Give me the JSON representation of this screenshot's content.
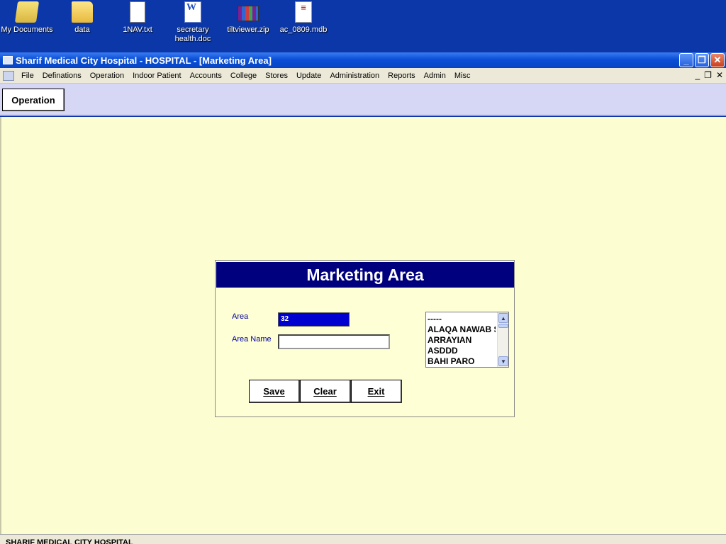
{
  "desktop": {
    "icons": [
      {
        "label": "My Documents",
        "icon": "my-documents-icon"
      },
      {
        "label": "data",
        "icon": "folder-icon"
      },
      {
        "label": "1NAV.txt",
        "icon": "text-file-icon"
      },
      {
        "label": "secretary health.doc",
        "icon": "word-document-icon"
      },
      {
        "label": "tiltviewer.zip",
        "icon": "winrar-archive-icon"
      },
      {
        "label": "ac_0809.mdb",
        "icon": "access-database-icon"
      }
    ]
  },
  "window": {
    "title": "Sharif Medical City Hospital - HOSPITAL - [Marketing Area]"
  },
  "menu": {
    "items": [
      "File",
      "Definations",
      "Operation",
      "Indoor Patient",
      "Accounts",
      "College",
      "Stores",
      "Update",
      "Administration",
      "Reports",
      "Admin",
      "Misc"
    ]
  },
  "toolbar": {
    "operation_label": "Operation"
  },
  "dialog": {
    "title": "Marketing Area",
    "area_label": "Area",
    "area_value": "32",
    "area_name_label": "Area Name",
    "area_name_value": "",
    "list_items": [
      "-----",
      "ALAQA NAWAB SAHIB",
      "ARRAYIAN",
      "ASDDD",
      "BAHI PARO"
    ],
    "save_label": "Save",
    "clear_label": "Clear",
    "exit_label": "Exit"
  },
  "status": {
    "text": "SHARIF MEDICAL CITY HOSPITAL"
  },
  "colors": {
    "dialog_header": "#00007f",
    "main_background": "#fdfdd2",
    "toolstrip": "#d6d6f5"
  }
}
